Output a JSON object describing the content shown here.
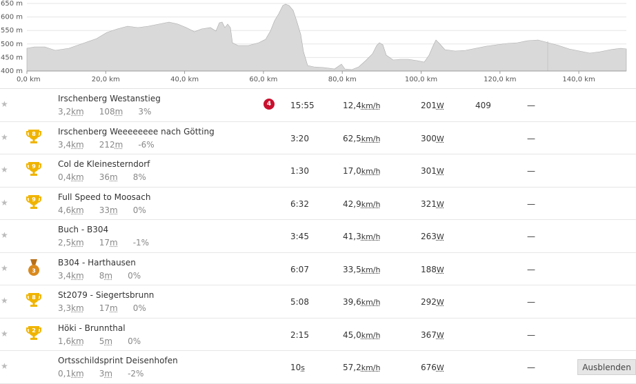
{
  "profile": {
    "y_ticks": [
      "650 m",
      "600 m",
      "550 m",
      "500 m",
      "450 m",
      "400 m"
    ],
    "x_ticks": [
      "0,0 km",
      "20,0 km",
      "40,0 km",
      "60,0 km",
      "80,0 km",
      "100,0 km",
      "120,0 km",
      "140,0 km"
    ],
    "fill_color": "#d9d9d9",
    "stroke_color": "#aaaaaa",
    "grid_color": "#e5e5e5"
  },
  "colors": {
    "gold": "#f0b400",
    "bronze": "#d98a1e",
    "rank_red": "#c8102e"
  },
  "segments": [
    {
      "name": "Irschenberg Westanstieg",
      "dist": "3,2",
      "dist_unit": "km",
      "elev": "108",
      "elev_unit": "m",
      "grade": "3%",
      "trophy": "",
      "trophy_type": "none",
      "rank_badge": "4",
      "time": "15:55",
      "speed": "12,4",
      "speed_unit": "km/h",
      "power": "201",
      "power_unit": "W",
      "extra": "409",
      "dash": "—",
      "button": ""
    },
    {
      "name": "Irschenberg Weeeeeeee nach Götting",
      "dist": "3,4",
      "dist_unit": "km",
      "elev": "212",
      "elev_unit": "m",
      "grade": "-6%",
      "trophy": "8",
      "trophy_type": "gold",
      "rank_badge": "",
      "time": "3:20",
      "speed": "62,5",
      "speed_unit": "km/h",
      "power": "300",
      "power_unit": "W",
      "extra": "",
      "dash": "—",
      "button": ""
    },
    {
      "name": "Col de Kleinesterndorf",
      "dist": "0,4",
      "dist_unit": "km",
      "elev": "36",
      "elev_unit": "m",
      "grade": "8%",
      "trophy": "9",
      "trophy_type": "gold",
      "rank_badge": "",
      "time": "1:30",
      "speed": "17,0",
      "speed_unit": "km/h",
      "power": "301",
      "power_unit": "W",
      "extra": "",
      "dash": "—",
      "button": ""
    },
    {
      "name": "Full Speed to Moosach",
      "dist": "4,6",
      "dist_unit": "km",
      "elev": "33",
      "elev_unit": "m",
      "grade": "0%",
      "trophy": "9",
      "trophy_type": "gold",
      "rank_badge": "",
      "time": "6:32",
      "speed": "42,9",
      "speed_unit": "km/h",
      "power": "321",
      "power_unit": "W",
      "extra": "",
      "dash": "—",
      "button": ""
    },
    {
      "name": "Buch - B304",
      "dist": "2,5",
      "dist_unit": "km",
      "elev": "17",
      "elev_unit": "m",
      "grade": "-1%",
      "trophy": "",
      "trophy_type": "none",
      "rank_badge": "",
      "time": "3:45",
      "speed": "41,3",
      "speed_unit": "km/h",
      "power": "263",
      "power_unit": "W",
      "extra": "",
      "dash": "—",
      "button": ""
    },
    {
      "name": "B304 - Harthausen",
      "dist": "3,4",
      "dist_unit": "km",
      "elev": "8",
      "elev_unit": "m",
      "grade": "0%",
      "trophy": "3",
      "trophy_type": "bronze",
      "rank_badge": "",
      "time": "6:07",
      "speed": "33,5",
      "speed_unit": "km/h",
      "power": "188",
      "power_unit": "W",
      "extra": "",
      "dash": "—",
      "button": ""
    },
    {
      "name": "St2079 - Siegertsbrunn",
      "dist": "3,3",
      "dist_unit": "km",
      "elev": "17",
      "elev_unit": "m",
      "grade": "0%",
      "trophy": "8",
      "trophy_type": "gold",
      "rank_badge": "",
      "time": "5:08",
      "speed": "39,6",
      "speed_unit": "km/h",
      "power": "292",
      "power_unit": "W",
      "extra": "",
      "dash": "—",
      "button": ""
    },
    {
      "name": "Höki - Brunnthal",
      "dist": "1,6",
      "dist_unit": "km",
      "elev": "5",
      "elev_unit": "m",
      "grade": "0%",
      "trophy": "2",
      "trophy_type": "gold",
      "rank_badge": "",
      "time": "2:15",
      "speed": "45,0",
      "speed_unit": "km/h",
      "power": "367",
      "power_unit": "W",
      "extra": "",
      "dash": "—",
      "button": ""
    },
    {
      "name": "Ortsschildsprint Deisenhofen",
      "dist": "0,1",
      "dist_unit": "km",
      "elev": "3",
      "elev_unit": "m",
      "grade": "-2%",
      "trophy": "",
      "trophy_type": "none",
      "rank_badge": "",
      "time": "10",
      "time_unit": "s",
      "speed": "57,2",
      "speed_unit": "km/h",
      "power": "676",
      "power_unit": "W",
      "extra": "",
      "dash": "—",
      "button": "Ausblenden"
    }
  ]
}
